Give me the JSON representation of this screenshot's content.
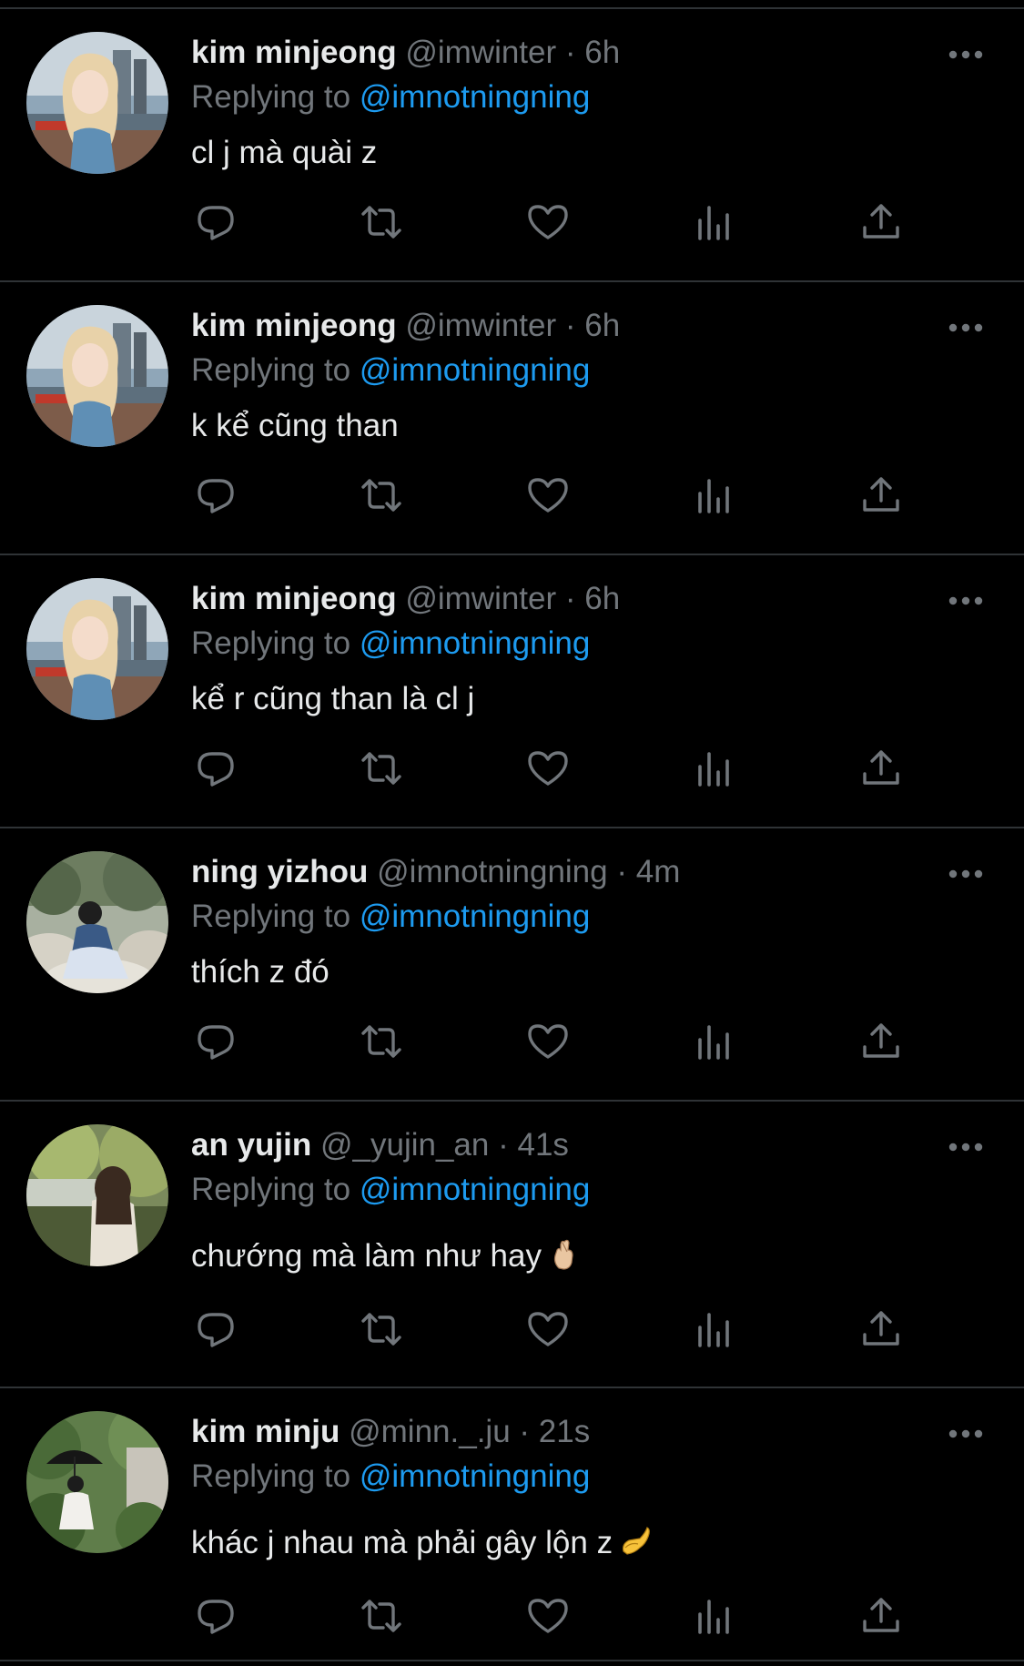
{
  "colors": {
    "background": "#000000",
    "text": "#e7e9ea",
    "muted": "#71767b",
    "link": "#1d9bf0",
    "divider": "#2f3336"
  },
  "labels": {
    "replying_prefix": "Replying to",
    "separator": "·"
  },
  "tweets": [
    {
      "name": "kim minjeong",
      "handle": "@imwinter",
      "time": "6h",
      "replying_to": "@imnotningning",
      "text": "cl j mà quài z",
      "avatar": "avatar-winter"
    },
    {
      "name": "kim minjeong",
      "handle": "@imwinter",
      "time": "6h",
      "replying_to": "@imnotningning",
      "text": "k kể cũng than",
      "avatar": "avatar-winter"
    },
    {
      "name": "kim minjeong",
      "handle": "@imwinter",
      "time": "6h",
      "replying_to": "@imnotningning",
      "text": "kể r cũng than là cl j",
      "avatar": "avatar-winter"
    },
    {
      "name": "ning yizhou",
      "handle": "@imnotningning",
      "time": "4m",
      "replying_to": "@imnotningning",
      "text": "thích z đó",
      "avatar": "avatar-ningning"
    },
    {
      "name": "an yujin",
      "handle": "@_yujin_an",
      "time": "41s",
      "replying_to": "@imnotningning",
      "text": "chướng mà làm như hay",
      "emoji": "crossed-fingers-emoji",
      "avatar": "avatar-yujin"
    },
    {
      "name": "kim minju",
      "handle": "@minn._.ju",
      "time": "21s",
      "replying_to": "@imnotningning",
      "text": "khác j nhau mà phải gây lộn z",
      "emoji": "pinching-hand-emoji",
      "avatar": "avatar-minju"
    }
  ],
  "action_icons": [
    "reply-icon",
    "retweet-icon",
    "like-icon",
    "views-icon",
    "share-icon"
  ]
}
